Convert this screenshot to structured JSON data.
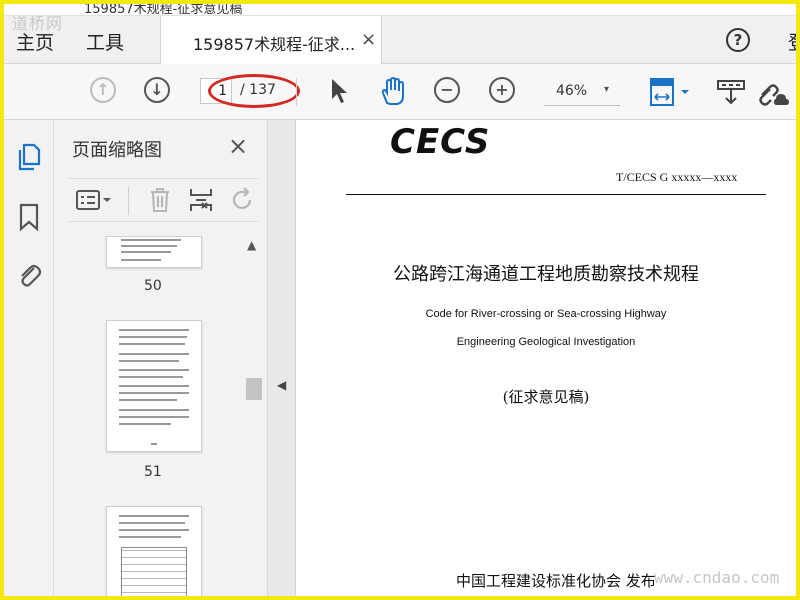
{
  "window": {
    "title_partial": "159857术规程-征求意见稿"
  },
  "watermarks": {
    "top": "道桥网",
    "bottom": "www.cndao.com"
  },
  "menu": {
    "home": "主页",
    "tools": "工具"
  },
  "tab": {
    "label": "159857术规程-征求...",
    "close": "×"
  },
  "header": {
    "help": "?",
    "login_partial": "登"
  },
  "toolbar": {
    "current_page": "1",
    "page_total": "/ 137",
    "zoom": "46%",
    "zoom_caret": "▾"
  },
  "thumb_panel": {
    "title": "页面缩略图",
    "close": "×",
    "pages": [
      "50",
      "51"
    ]
  },
  "document": {
    "logo": "CECS",
    "standard_no": "T/CECS G xxxxx—xxxx",
    "title_cn": "公路跨江海通道工程地质勘察技术规程",
    "title_en_line1": "Code for River-crossing or Sea-crossing Highway",
    "title_en_line2": "Engineering Geological Investigation",
    "status": "(征求意见稿)",
    "publisher": "中国工程建设标准化协会  发布"
  },
  "colors": {
    "highlight_ellipse": "#d22a22",
    "accent_blue": "#1a73c8",
    "border": "#f3e80f"
  }
}
